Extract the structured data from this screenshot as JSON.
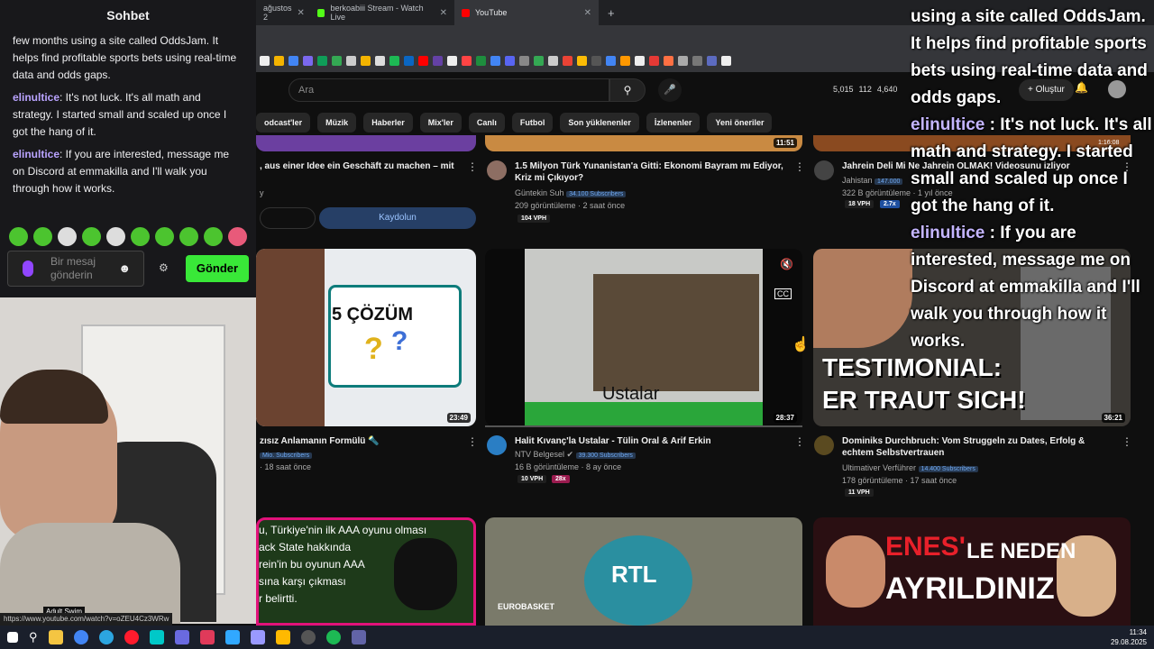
{
  "browser": {
    "tabs": [
      {
        "label": "ağustos 2",
        "color": "#888888"
      },
      {
        "label": "berkoabiii Stream - Watch Live",
        "color": "#53fc18"
      },
      {
        "label": "YouTube",
        "color": "#ff0000"
      }
    ],
    "newtab": "+"
  },
  "youtube": {
    "search_placeholder": "Ara",
    "stats": {
      "a": "5,015",
      "b": "112",
      "c": "4,640"
    },
    "create_label": "Oluştur",
    "chips": [
      "odcast'ler",
      "Müzik",
      "Haberler",
      "Mix'ler",
      "Canlı",
      "Futbol",
      "Son yüklenenler",
      "İzlenenler",
      "Yeni öneriler"
    ],
    "subscribe_label": "Kaydolun",
    "top_durations": [
      "11:51",
      "1:16:08"
    ],
    "row1": [
      {
        "title": ", aus einer Idee ein Geschäft zu machen – mit",
        "meta": "y"
      },
      {
        "title": "1.5 Milyon Türk Yunanistan'a Gitti: Ekonomi Bayram mı Ediyor, Kriz mi Çıkıyor?",
        "channel": "Güntekin Suh",
        "subs": "34.100 Subscribers",
        "views": "209 görüntüleme · 2 saat önce",
        "vph": "104 VPH"
      },
      {
        "title": "Jahrein Deli Mi Ne Jahrein OLMAK! Videosunu izliyor",
        "channel": "Jahistan",
        "subs": "147.000",
        "views": "322 B görüntüleme · 1 yıl önce",
        "vph": "18 VPH",
        "ratio": "2.7x"
      }
    ],
    "row2": [
      {
        "thumb_text": "5 ÇÖZÜM",
        "duration": "23:49",
        "title": "zısız Anlamanın Formülü 🔦",
        "subs": "Mio. Subscribers",
        "views": "· 18 saat önce"
      },
      {
        "thumb_text": "Ustalar",
        "duration": "28:37",
        "title": "Halit Kıvanç'la Ustalar - Tülin Oral & Arif Erkin",
        "channel": "NTV Belgesel",
        "subs": "39.300 Subscribers",
        "views": "16 B görüntüleme · 8 ay önce",
        "vph": "10 VPH",
        "ratio": "28x"
      },
      {
        "thumb_text1": "TESTIMONIAL:",
        "thumb_text2": "ER TRAUT SICH!",
        "duration": "36:21",
        "title": "Dominiks Durchbruch: Vom Struggeln zu Dates, Erfolg & echtem Selbstvertrauen",
        "channel": "Ultimativer Verführer",
        "subs": "14.400 Subscribers",
        "views": "178 görüntüleme · 17 saat önce",
        "vph": "11 VPH"
      }
    ],
    "row3": [
      {
        "lines": [
          "u, Türkiye'nin ilk AAA oyunu olması",
          "ack State hakkında",
          "rein'in bu oyunun AAA",
          "sına karşı çıkması",
          "r belirtti."
        ]
      },
      {
        "thumb_text": "RTL",
        "sub_text": "EUROBASKET"
      },
      {
        "thumb_text1": "ENES'",
        "thumb_text2": "LE NEDEN",
        "thumb_text3": "AYRILDINIZ"
      }
    ]
  },
  "chat": {
    "title": "Sohbet",
    "messages": [
      {
        "user": "",
        "text": "few months using a site called OddsJam. It helps find profitable sports bets using real-time data and odds gaps."
      },
      {
        "user": "elinultice",
        "text": ": It's not luck. It's all math and strategy. I started small and scaled up once I got the hang of it."
      },
      {
        "user": "elinultice",
        "text": ": If you are interested, message me on Discord at emmakilla and I'll walk you through how it works."
      }
    ],
    "input_placeholder": "Bir mesaj gönderin",
    "send_label": "Gönder"
  },
  "overlay": {
    "line1": "using a site called OddsJam. It helps find profitable sports bets using real-time data and odds gaps.",
    "user1": "elinultice",
    "line2": " : It's not luck. It's all math and strategy. I started small and scaled up once I got the hang of it.",
    "user2": "elinultice",
    "line3": " : If you are interested, message me on Discord at emmakilla and I'll walk you through how it works."
  },
  "status_url": "https://www.youtube.com/watch?v=oZEU4Cz3WRw",
  "webcam_label": "Adult Swim",
  "clock": {
    "time": "11:34",
    "date": "29.08.2025"
  }
}
